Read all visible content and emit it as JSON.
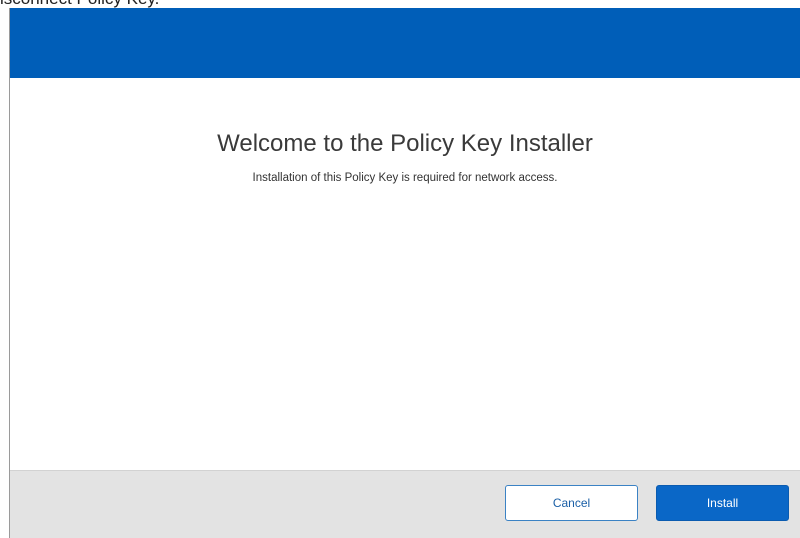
{
  "window": {
    "title_fragment": "isconnect Policy Key."
  },
  "header": {
    "accent_color": "#005eb8"
  },
  "content": {
    "heading": "Welcome to the Policy Key Installer",
    "description": "Installation of this Policy Key is required for network access."
  },
  "footer": {
    "cancel_label": "Cancel",
    "install_label": "Install"
  }
}
